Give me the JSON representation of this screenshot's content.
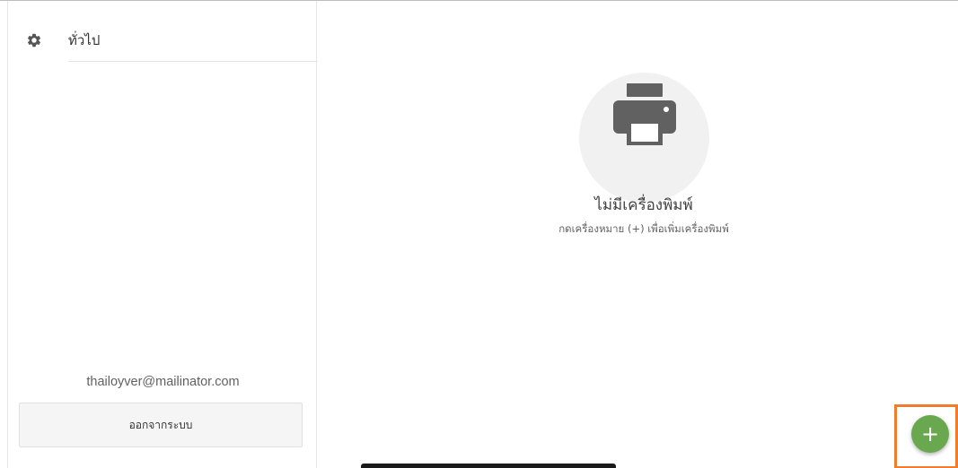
{
  "sidebar": {
    "items": [
      {
        "label": "ทั่วไป",
        "icon": "gear-icon"
      }
    ],
    "account_email": "thailoyver@mailinator.com",
    "logout_label": "ออกจากระบบ"
  },
  "main": {
    "empty_state": {
      "icon": "printer-icon",
      "title": "ไม่มีเครื่องพิมพ์",
      "hint": "กดเครื่องหมาย (+) เพื่อเพิ่มเครื่องพิมพ์"
    },
    "fab": {
      "label": "+",
      "icon": "plus-icon",
      "color": "#6aa84f",
      "highlight_color": "#f07d2e"
    }
  }
}
